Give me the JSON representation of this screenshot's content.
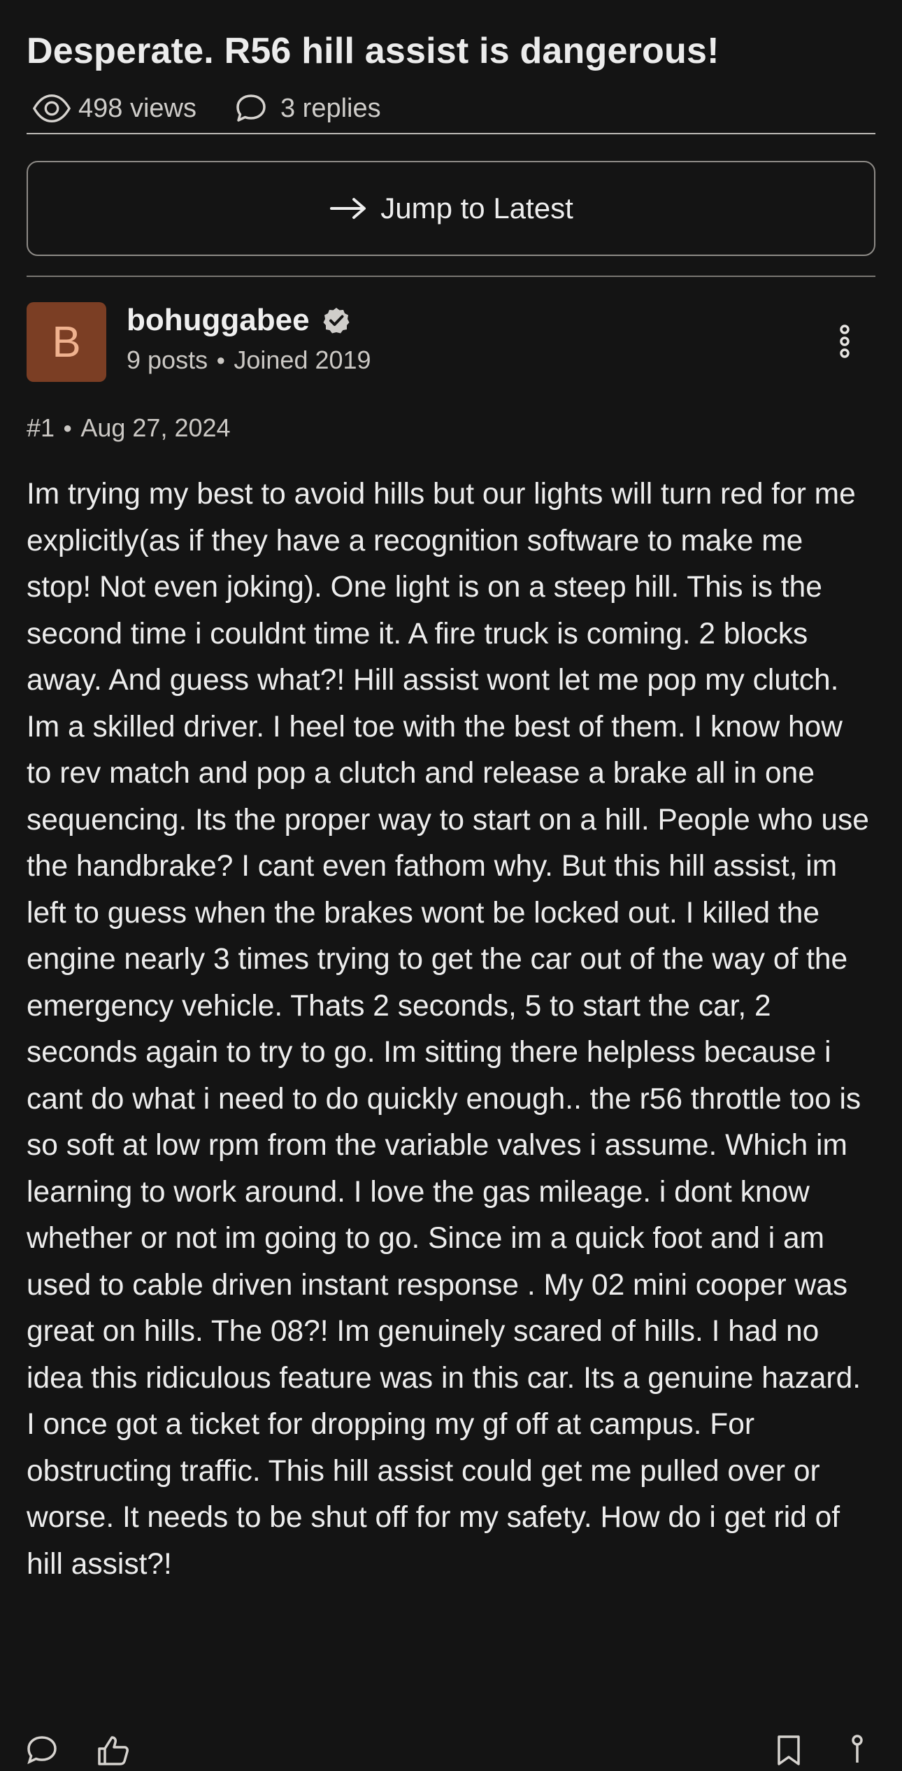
{
  "thread": {
    "title": "Desperate. R56 hill assist is dangerous!",
    "views": "498 views",
    "replies": "3 replies"
  },
  "jump": {
    "label": "Jump to Latest"
  },
  "post": {
    "author": {
      "initial": "B",
      "name": "bohuggabee",
      "posts": "9 posts",
      "joined": "Joined 2019"
    },
    "number": "#1",
    "date": "Aug 27, 2024",
    "body": "Im trying my best to avoid hills but our lights will turn red for me explicitly(as if they have a recognition software to make me stop! Not even joking). One light is on a steep hill. This is the second time i couldnt time it. A fire truck is coming. 2 blocks away. And guess what?! Hill assist wont let me pop my clutch. Im a skilled driver. I heel toe with the best of them. I know how to rev match and pop a clutch and release a brake all in one sequencing. Its the proper way to start on a hill. People who use the handbrake? I cant even fathom why. But this hill assist, im left to guess when the brakes wont be locked out. I killed the engine nearly 3 times trying to get the car out of the way of the emergency vehicle. Thats 2 seconds, 5 to start the car, 2 seconds again to try to go. Im sitting there helpless because i cant do what i need to do quickly enough.. the r56 throttle too is so soft at low rpm from the variable valves i assume. Which im learning to work around. I love the gas mileage. i dont know whether or not im going to go. Since im a quick foot and i am used to cable driven instant response . My 02 mini cooper was great on hills. The 08?! Im genuinely scared of hills. I had no idea this ridiculous feature was in this car. Its a genuine hazard. I once got a ticket for dropping my gf off at campus. For obstructing traffic. This hill assist could get me pulled over or worse. It needs to be shut off for my safety. How do i get rid of hill assist?!"
  },
  "icons": {
    "views": "eye-icon",
    "replies": "speech-bubble-icon",
    "jump": "arrow-right-icon",
    "verified": "verified-check-icon",
    "more": "vertical-ellipsis-icon"
  },
  "colors": {
    "background": "#141414",
    "text": "#e8e6e3",
    "muted_text": "#cbc8c4",
    "avatar_bg": "#7b3e24",
    "avatar_text": "#f0b28f",
    "border": "#8e8b87"
  }
}
